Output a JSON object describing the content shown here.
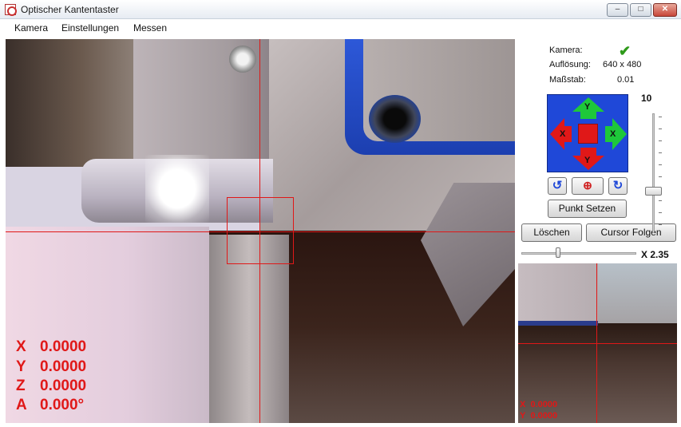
{
  "window": {
    "title": "Optischer Kantentaster",
    "minimize_glyph": "–",
    "maximize_glyph": "□",
    "close_glyph": "✕"
  },
  "menu": {
    "items": [
      "Kamera",
      "Einstellungen",
      "Messen"
    ]
  },
  "camera_view": {
    "coords": [
      {
        "label": "X",
        "value": "0.0000"
      },
      {
        "label": "Y",
        "value": "0.0000"
      },
      {
        "label": "Z",
        "value": "0.0000"
      },
      {
        "label": "A",
        "value": "0.000°"
      }
    ],
    "crosshair_color": "#e01818"
  },
  "panel": {
    "kamera_label": "Kamera:",
    "kamera_status_icon": "check-icon",
    "aufloesung_label": "Auflösung:",
    "aufloesung_value": "640 x 480",
    "massstab_label": "Maßstab:",
    "massstab_value": "0.01",
    "dpad": {
      "up": "Y",
      "down": "Y",
      "left": "X",
      "right": "X"
    },
    "rotate_left_glyph": "↺",
    "center_glyph": "⊕",
    "rotate_right_glyph": "↻",
    "punkt_setzen": "Punkt Setzen",
    "loeschen": "Löschen",
    "cursor_folgen": "Cursor Folgen",
    "vertical_slider_value": "10",
    "vertical_slider_level": 0.35,
    "zoom_slider_level": 0.32,
    "zoom_label": "X 2.35"
  },
  "zoom_view": {
    "coords": [
      {
        "label": "X",
        "value": "0.0000"
      },
      {
        "label": "Y",
        "value": "0.0000"
      }
    ]
  }
}
